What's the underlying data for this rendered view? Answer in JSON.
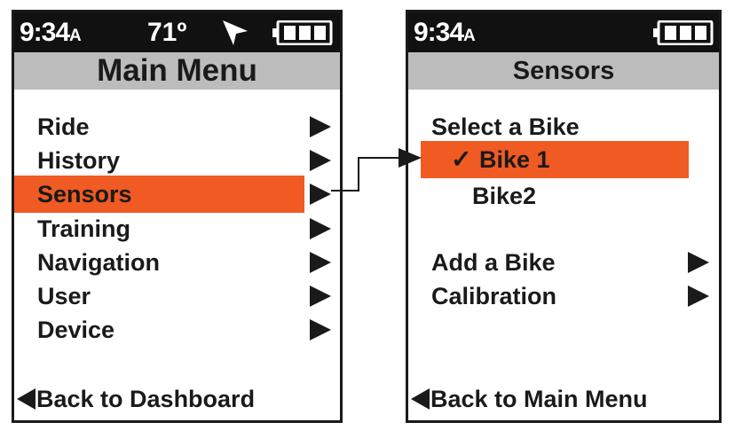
{
  "colors": {
    "highlight": "#f05a23",
    "status_bar": "#111111",
    "title_bar": "#bcbcbc",
    "text": "#1a1a1a"
  },
  "main_menu": {
    "status": {
      "time": "9:34",
      "ampm": "A",
      "temperature": "71º",
      "gps_icon": "navigation-arrow",
      "battery_icon": "battery-full"
    },
    "title": "Main Menu",
    "items": [
      {
        "label": "Ride",
        "selected": false
      },
      {
        "label": "History",
        "selected": false
      },
      {
        "label": "Sensors",
        "selected": true
      },
      {
        "label": "Training",
        "selected": false
      },
      {
        "label": "Navigation",
        "selected": false
      },
      {
        "label": "User",
        "selected": false
      },
      {
        "label": "Device",
        "selected": false
      }
    ],
    "back_label": "Back to Dashboard"
  },
  "sensors_menu": {
    "status": {
      "time": "9:34",
      "ampm": "A",
      "battery_icon": "battery-full"
    },
    "title": "Sensors",
    "select_heading": "Select a Bike",
    "bikes": [
      {
        "label": "Bike 1",
        "checked": true,
        "check_mark": "✓"
      },
      {
        "label": "Bike2",
        "checked": false
      }
    ],
    "actions": [
      {
        "label": "Add a Bike"
      },
      {
        "label": "Calibration"
      }
    ],
    "back_label": "Back to Main Menu"
  }
}
